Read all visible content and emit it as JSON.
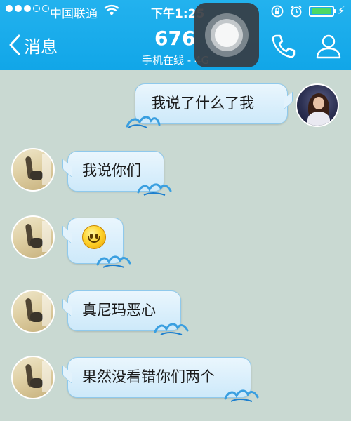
{
  "status_bar": {
    "carrier": "中国联通",
    "time": "下午1:25",
    "signal_dots_filled": 3,
    "signal_dots_total": 5,
    "battery_level": 0.9
  },
  "header": {
    "back_label": "消息",
    "title": "676",
    "subtitle": "手机在线 - 4G"
  },
  "colors": {
    "header_blue": "#19aaea",
    "chat_background": "#c9d9d2",
    "bubble_fill": "#d6edfb",
    "bubble_border": "#8fc9ec"
  },
  "messages": [
    {
      "side": "outgoing",
      "type": "text",
      "text": "我说了什么了我"
    },
    {
      "side": "incoming",
      "type": "text",
      "text": "我说你们"
    },
    {
      "side": "incoming",
      "type": "emoji",
      "emoji": "smiley-face"
    },
    {
      "side": "incoming",
      "type": "text",
      "text": "真尼玛恶心"
    },
    {
      "side": "incoming",
      "type": "text",
      "text": "果然没看错你们两个"
    }
  ]
}
